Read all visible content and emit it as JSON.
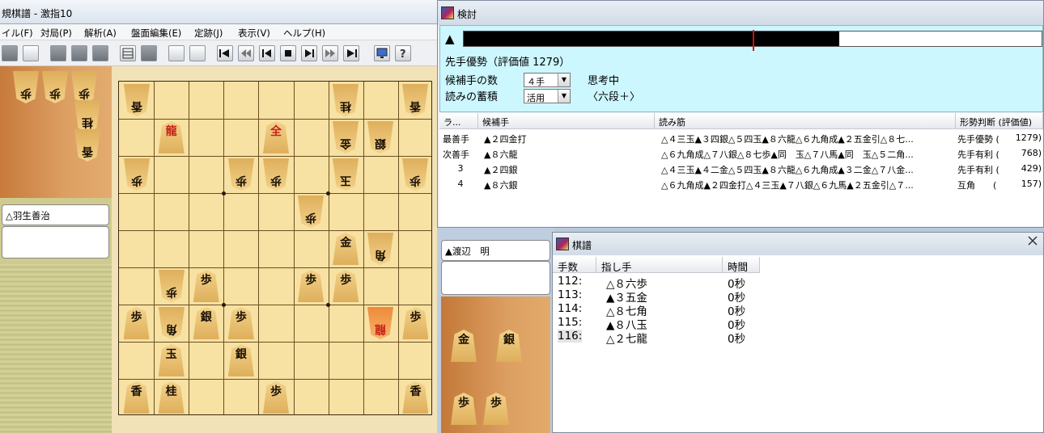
{
  "main_window": {
    "title": "規棋譜 - 激指10",
    "menu": [
      "イル(F)",
      "対局(P)",
      "解析(A)",
      "盤面編集(E)",
      "定跡(J)",
      "表示(V)",
      "ヘルプ(H)"
    ]
  },
  "players": {
    "gote_name": "△羽生善治",
    "sente_name": "▲渡辺　明"
  },
  "hands": {
    "gote": [
      "歩",
      "歩",
      "歩",
      "桂",
      "香"
    ],
    "sente": [
      "金",
      "銀",
      "歩",
      "歩"
    ]
  },
  "board": [
    {
      "file": 9,
      "rank": 1,
      "piece": "香",
      "owner": "gote"
    },
    {
      "file": 3,
      "rank": 1,
      "piece": "桂",
      "owner": "gote"
    },
    {
      "file": 1,
      "rank": 1,
      "piece": "香",
      "owner": "gote"
    },
    {
      "file": 8,
      "rank": 2,
      "piece": "龍",
      "owner": "sente",
      "red": true
    },
    {
      "file": 5,
      "rank": 2,
      "piece": "全",
      "owner": "sente",
      "red": true
    },
    {
      "file": 3,
      "rank": 2,
      "piece": "金",
      "owner": "gote"
    },
    {
      "file": 2,
      "rank": 2,
      "piece": "銀",
      "owner": "gote"
    },
    {
      "file": 9,
      "rank": 3,
      "piece": "歩",
      "owner": "gote"
    },
    {
      "file": 6,
      "rank": 3,
      "piece": "歩",
      "owner": "gote"
    },
    {
      "file": 5,
      "rank": 3,
      "piece": "歩",
      "owner": "gote"
    },
    {
      "file": 3,
      "rank": 3,
      "piece": "玉",
      "owner": "gote"
    },
    {
      "file": 1,
      "rank": 3,
      "piece": "歩",
      "owner": "gote"
    },
    {
      "file": 4,
      "rank": 4,
      "piece": "歩",
      "owner": "gote"
    },
    {
      "file": 3,
      "rank": 5,
      "piece": "金",
      "owner": "sente"
    },
    {
      "file": 2,
      "rank": 5,
      "piece": "角",
      "owner": "gote"
    },
    {
      "file": 8,
      "rank": 6,
      "piece": "歩",
      "owner": "gote"
    },
    {
      "file": 7,
      "rank": 6,
      "piece": "歩",
      "owner": "sente"
    },
    {
      "file": 4,
      "rank": 6,
      "piece": "歩",
      "owner": "sente"
    },
    {
      "file": 3,
      "rank": 6,
      "piece": "歩",
      "owner": "sente"
    },
    {
      "file": 9,
      "rank": 7,
      "piece": "歩",
      "owner": "sente"
    },
    {
      "file": 8,
      "rank": 7,
      "piece": "角",
      "owner": "gote"
    },
    {
      "file": 7,
      "rank": 7,
      "piece": "銀",
      "owner": "sente"
    },
    {
      "file": 6,
      "rank": 7,
      "piece": "歩",
      "owner": "sente"
    },
    {
      "file": 2,
      "rank": 7,
      "piece": "龍",
      "owner": "gote",
      "red": true,
      "selected": true
    },
    {
      "file": 1,
      "rank": 7,
      "piece": "歩",
      "owner": "sente"
    },
    {
      "file": 8,
      "rank": 8,
      "piece": "玉",
      "owner": "sente"
    },
    {
      "file": 6,
      "rank": 8,
      "piece": "銀",
      "owner": "sente"
    },
    {
      "file": 9,
      "rank": 9,
      "piece": "香",
      "owner": "sente"
    },
    {
      "file": 8,
      "rank": 9,
      "piece": "桂",
      "owner": "sente"
    },
    {
      "file": 5,
      "rank": 9,
      "piece": "歩",
      "owner": "sente"
    },
    {
      "file": 1,
      "rank": 9,
      "piece": "香",
      "owner": "sente"
    }
  ],
  "analysis": {
    "title": "検討",
    "eval_prefix": "▲",
    "eval_fraction": 0.65,
    "marker_fraction": 0.5,
    "status_text": "先手優勢（評価値 1279）",
    "candidates_label": "候補手の数",
    "candidates_value": "４手",
    "thinking_text": "思考中",
    "accumulate_label": "読みの蓄積",
    "accumulate_value": "活用",
    "level_text": "〈六段＋〉",
    "columns": [
      "ラ...",
      "候補手",
      "読み筋",
      "形勢判断 (評価値)"
    ],
    "rows": [
      {
        "rank": "最善手",
        "move": "▲２四金打",
        "pv": "△４三玉▲３四銀△５四玉▲８六龍△６九角成▲２五金引△８七...",
        "judge": "先手優勢 (",
        "value": "1279)"
      },
      {
        "rank": "次善手",
        "move": "▲８六龍",
        "pv": "△６九角成△７八銀△８七歩▲同　玉△７八馬▲同　玉△５二角...",
        "judge": "先手有利 (",
        "value": "768)"
      },
      {
        "rank": "3",
        "move": "▲２四銀",
        "pv": "△４三玉▲４二金△５四玉▲８六龍△６九角成▲３二金△７八金...",
        "judge": "先手有利 (",
        "value": "429)"
      },
      {
        "rank": "4",
        "move": "▲８六銀",
        "pv": "△６九角成▲２四金打△４三玉▲７八銀△６九馬▲２五金引△７...",
        "judge": "互角　　(",
        "value": "157)"
      }
    ]
  },
  "kifu": {
    "title": "棋譜",
    "columns": [
      "手数",
      "指し手",
      "時間"
    ],
    "rows": [
      {
        "num": "112:",
        "move": "△８六歩",
        "time": "0秒"
      },
      {
        "num": "113:",
        "move": "▲３五金",
        "time": "0秒"
      },
      {
        "num": "114:",
        "move": "△８七角",
        "time": "0秒"
      },
      {
        "num": "115:",
        "move": "▲８八玉",
        "time": "0秒"
      },
      {
        "num": "116:",
        "move": "△２七龍",
        "time": "0秒"
      }
    ]
  },
  "icons": {
    "app": "shogi-app-icon",
    "close": "close-icon"
  }
}
